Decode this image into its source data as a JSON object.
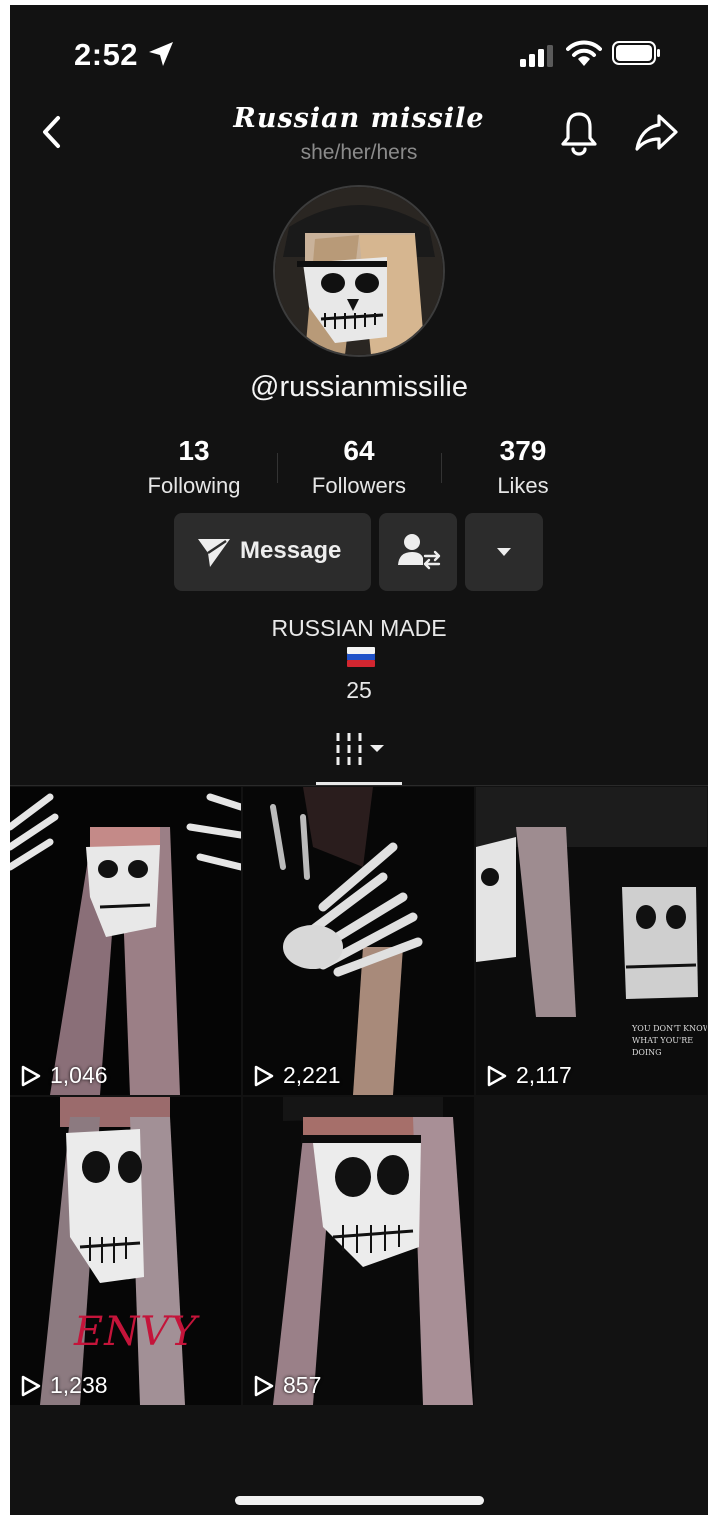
{
  "status_bar": {
    "time": "2:52"
  },
  "header": {
    "title": "Russian missile",
    "pronouns": "she/her/hers"
  },
  "profile": {
    "username": "@russianmissilie",
    "stats": [
      {
        "value": "13",
        "label": "Following"
      },
      {
        "value": "64",
        "label": "Followers"
      },
      {
        "value": "379",
        "label": "Likes"
      }
    ],
    "message_label": "Message",
    "bio_line1": "RUSSIAN MADE",
    "bio_flag": "🇷🇺",
    "bio_line2": "25"
  },
  "icons": {
    "back": "chevron-left-icon",
    "bell": "bell-icon",
    "share": "share-arrow-icon",
    "message": "paper-plane-icon",
    "friend": "user-swap-icon",
    "more": "caret-down-icon",
    "tab": "grid-bars-icon"
  },
  "videos": [
    {
      "views": "1,046"
    },
    {
      "views": "2,221"
    },
    {
      "views": "2,117",
      "caption": "YOU DON'T KNOW WHAT YOU'RE DOING"
    },
    {
      "views": "1,238",
      "caption": "ENVY"
    },
    {
      "views": "857"
    }
  ],
  "colors": {
    "background": "#121212",
    "button": "#2c2c2c",
    "envy_red": "#c4143a"
  }
}
